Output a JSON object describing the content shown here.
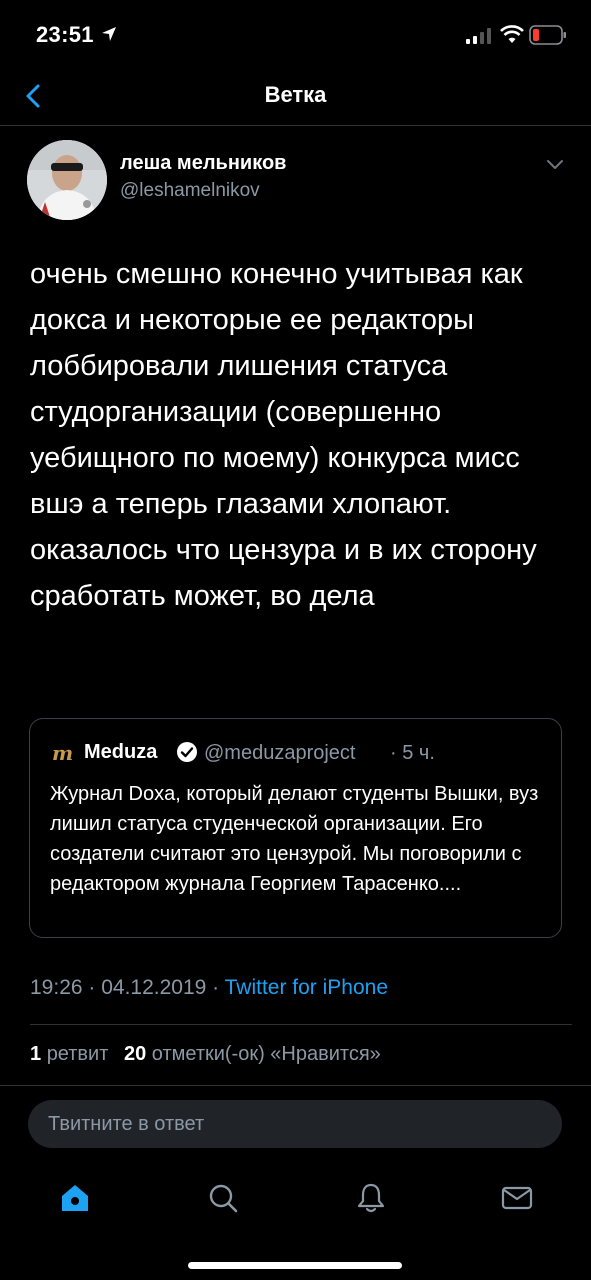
{
  "status": {
    "time": "23:51"
  },
  "nav": {
    "title": "Ветка"
  },
  "tweet": {
    "author_name": "леша мельников",
    "author_handle": "@leshamelnikov",
    "text": "очень смешно конечно учитывая как докса и некоторые ее редакторы лоббировали лишения статуса студорганизации (совершенно уебищного по моему) конкурса мисс вшэ а теперь глазами хлопают. оказалось что цензура и в их сторону сработать может, во дела",
    "time": "19:26 · 04.12.2019 · ",
    "source": "Twitter for iPhone"
  },
  "quote": {
    "logo": "m",
    "name": "Meduza",
    "handle": "@meduzaproject",
    "time": "· 5 ч.",
    "text": "Журнал Doxa, который делают студенты Вышки, вуз лишил статуса студенческой организации. Его создатели считают это цензурой. Мы поговорили с редактором журнала Георгием Тарасенко...."
  },
  "stats": {
    "retweets_count": "1",
    "retweets_label": "ретвит",
    "likes_count": "20",
    "likes_label": "отметки(-ок) «Нравится»"
  },
  "reply": {
    "placeholder": "Твитните в ответ"
  },
  "tabs": [
    "home-icon",
    "search-icon",
    "notifications-icon",
    "messages-icon"
  ],
  "colors": {
    "accent": "#1da1f2",
    "secondary_text": "#8b98a5",
    "background": "#000000",
    "meduza_gold": "#c99a4a"
  }
}
